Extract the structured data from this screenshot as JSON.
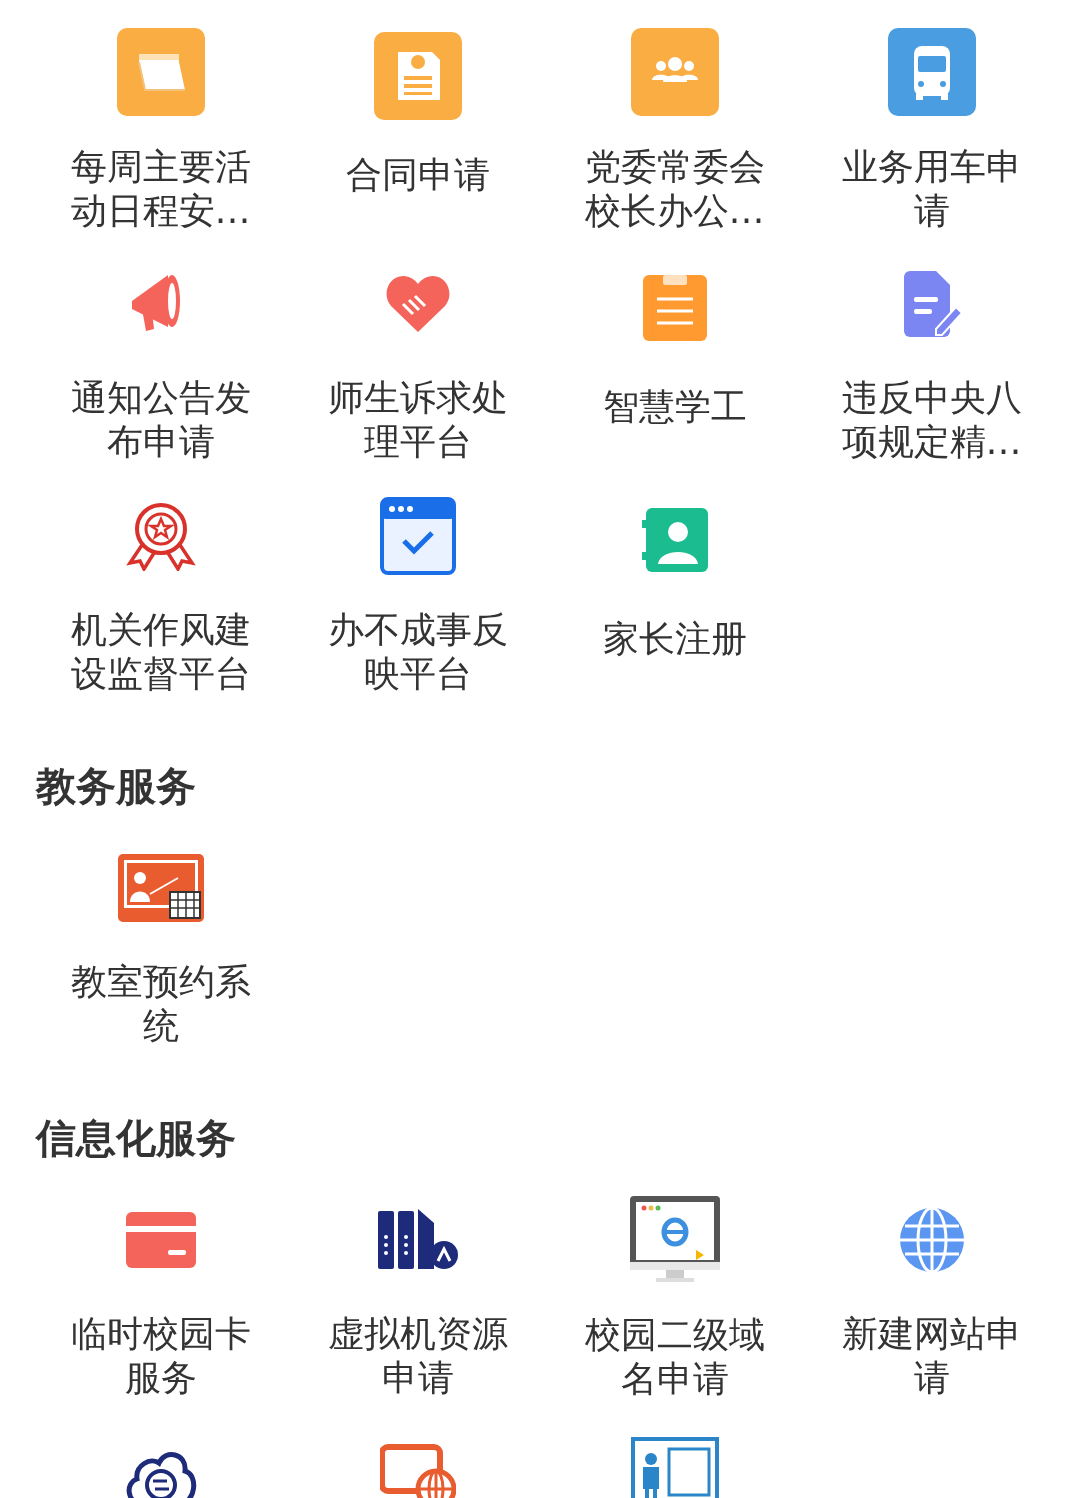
{
  "sections": [
    {
      "items": [
        {
          "kind": "app",
          "label": "每周主要活动日程安…"
        },
        {
          "kind": "app",
          "label": "合同申请"
        },
        {
          "kind": "app",
          "label": "党委常委会校长办公…"
        },
        {
          "kind": "app",
          "label": "业务用车申请"
        },
        {
          "kind": "app",
          "label": "通知公告发布申请"
        },
        {
          "kind": "app",
          "label": "师生诉求处理平台"
        },
        {
          "kind": "app",
          "label": "智慧学工"
        },
        {
          "kind": "app",
          "label": "违反中央八项规定精…"
        },
        {
          "kind": "app",
          "label": "机关作风建设监督平台"
        },
        {
          "kind": "app",
          "label": "办不成事反映平台"
        },
        {
          "kind": "app",
          "label": "家长注册"
        }
      ]
    },
    {
      "title": "教务服务",
      "items": [
        {
          "kind": "app",
          "label": "教室预约系统"
        }
      ]
    },
    {
      "title": "信息化服务",
      "items": [
        {
          "kind": "app",
          "label": "临时校园卡服务"
        },
        {
          "kind": "app",
          "label": "虚拟机资源申请"
        },
        {
          "kind": "app",
          "label": "校园二级域名申请"
        },
        {
          "kind": "app",
          "label": "新建网站申请"
        },
        {
          "kind": "icon_only"
        },
        {
          "kind": "icon_only"
        },
        {
          "kind": "icon_only"
        }
      ]
    }
  ]
}
